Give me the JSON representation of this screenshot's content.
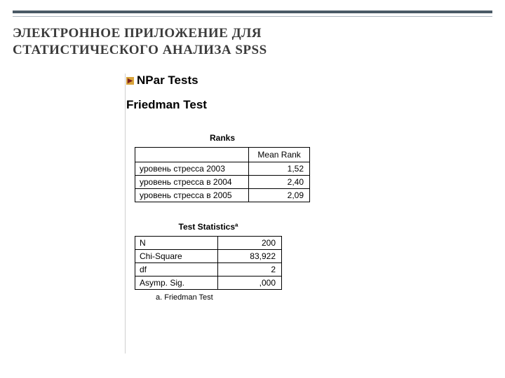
{
  "slide": {
    "title_line1": "ЭЛЕКТРОННОЕ  ПРИЛОЖЕНИЕ  ДЛЯ",
    "title_line2": "СТАТИСТИЧЕСКОГО  АНАЛИЗА   SPSS"
  },
  "output": {
    "section_heading": "NPar Tests",
    "test_heading": "Friedman Test",
    "ranks": {
      "caption": "Ranks",
      "col_header": "Mean Rank",
      "rows": [
        {
          "label": "уровень стресса 2003",
          "value": "1,52"
        },
        {
          "label": "уровень стресса в 2004",
          "value": "2,40"
        },
        {
          "label": "уровень стресса в 2005",
          "value": "2,09"
        }
      ]
    },
    "stats": {
      "caption": "Test Statisticsª",
      "rows": [
        {
          "label": "N",
          "value": "200"
        },
        {
          "label": "Chi-Square",
          "value": "83,922"
        },
        {
          "label": "df",
          "value": "2"
        },
        {
          "label": "Asymp. Sig.",
          "value": ",000"
        }
      ],
      "footnote": "a. Friedman Test"
    }
  }
}
